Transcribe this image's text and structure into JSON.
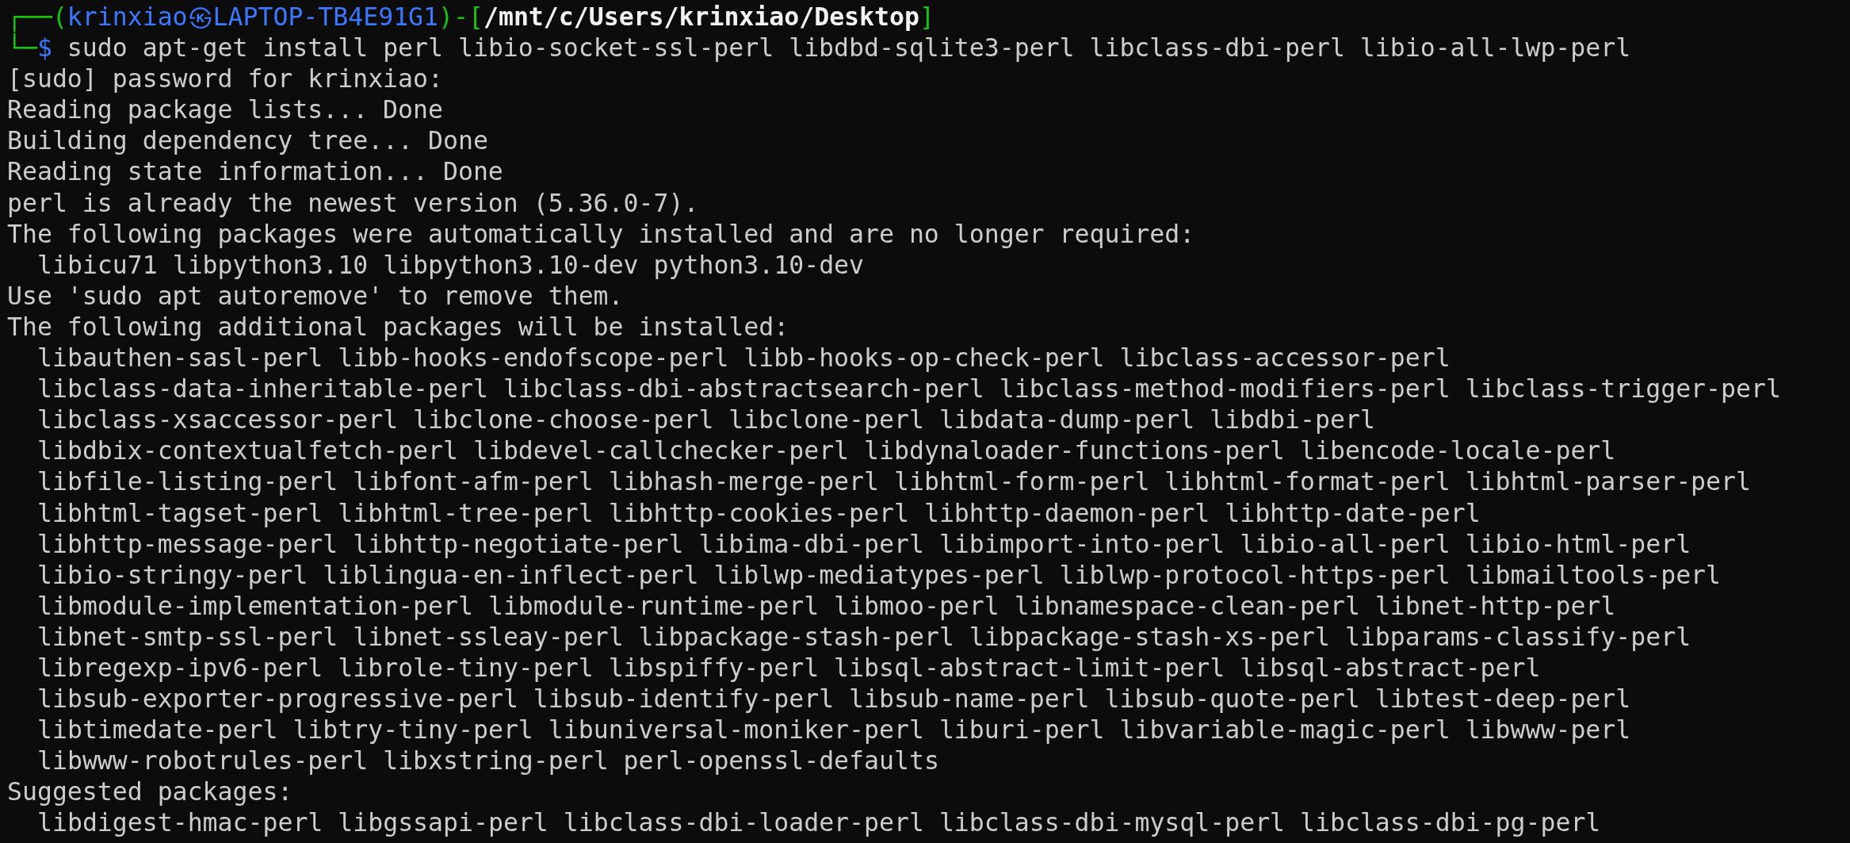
{
  "prompt": {
    "segments": [
      {
        "text": "┌──(",
        "kind": "frame"
      },
      {
        "text": "krinxiao㉿LAPTOP-TB4E91G1",
        "kind": "host"
      },
      {
        "text": ")-[",
        "kind": "frame"
      },
      {
        "text": "/mnt/c/Users/krinxiao/Desktop",
        "kind": "path"
      },
      {
        "text": "]",
        "kind": "frame"
      }
    ]
  },
  "command": {
    "segments": [
      {
        "text": "└─",
        "kind": "frame"
      },
      {
        "text": "$",
        "kind": "host"
      },
      {
        "text": " sudo apt-get install perl libio-socket-ssl-perl libdbd-sqlite3-perl libclass-dbi-perl libio-all-lwp-perl",
        "kind": "plain"
      }
    ]
  },
  "output": [
    {
      "kind": "line",
      "text": "[sudo] password for krinxiao:"
    },
    {
      "kind": "line",
      "text": "Reading package lists... Done"
    },
    {
      "kind": "line",
      "text": "Building dependency tree... Done"
    },
    {
      "kind": "line",
      "text": "Reading state information... Done"
    },
    {
      "kind": "line",
      "text": "perl is already the newest version (5.36.0-7)."
    },
    {
      "kind": "line",
      "text": "The following packages were automatically installed and are no longer required:"
    },
    {
      "kind": "indented",
      "text": "libicu71 libpython3.10 libpython3.10-dev python3.10-dev"
    },
    {
      "kind": "line",
      "text": "Use 'sudo apt autoremove' to remove them."
    },
    {
      "kind": "line",
      "text": "The following additional packages will be installed:"
    },
    {
      "kind": "indented",
      "text": "libauthen-sasl-perl libb-hooks-endofscope-perl libb-hooks-op-check-perl libclass-accessor-perl"
    },
    {
      "kind": "indented",
      "text": "libclass-data-inheritable-perl libclass-dbi-abstractsearch-perl libclass-method-modifiers-perl libclass-trigger-perl"
    },
    {
      "kind": "indented",
      "text": "libclass-xsaccessor-perl libclone-choose-perl libclone-perl libdata-dump-perl libdbi-perl"
    },
    {
      "kind": "indented",
      "text": "libdbix-contextualfetch-perl libdevel-callchecker-perl libdynaloader-functions-perl libencode-locale-perl"
    },
    {
      "kind": "indented",
      "text": "libfile-listing-perl libfont-afm-perl libhash-merge-perl libhtml-form-perl libhtml-format-perl libhtml-parser-perl"
    },
    {
      "kind": "indented",
      "text": "libhtml-tagset-perl libhtml-tree-perl libhttp-cookies-perl libhttp-daemon-perl libhttp-date-perl"
    },
    {
      "kind": "indented",
      "text": "libhttp-message-perl libhttp-negotiate-perl libima-dbi-perl libimport-into-perl libio-all-perl libio-html-perl"
    },
    {
      "kind": "indented",
      "text": "libio-stringy-perl liblingua-en-inflect-perl liblwp-mediatypes-perl liblwp-protocol-https-perl libmailtools-perl"
    },
    {
      "kind": "indented",
      "text": "libmodule-implementation-perl libmodule-runtime-perl libmoo-perl libnamespace-clean-perl libnet-http-perl"
    },
    {
      "kind": "indented",
      "text": "libnet-smtp-ssl-perl libnet-ssleay-perl libpackage-stash-perl libpackage-stash-xs-perl libparams-classify-perl"
    },
    {
      "kind": "indented",
      "text": "libregexp-ipv6-perl librole-tiny-perl libspiffy-perl libsql-abstract-limit-perl libsql-abstract-perl"
    },
    {
      "kind": "indented",
      "text": "libsub-exporter-progressive-perl libsub-identify-perl libsub-name-perl libsub-quote-perl libtest-deep-perl"
    },
    {
      "kind": "indented",
      "text": "libtimedate-perl libtry-tiny-perl libuniversal-moniker-perl liburi-perl libvariable-magic-perl libwww-perl"
    },
    {
      "kind": "indented",
      "text": "libwww-robotrules-perl libxstring-perl perl-openssl-defaults"
    },
    {
      "kind": "line",
      "text": "Suggested packages:"
    },
    {
      "kind": "indented",
      "text": "libdigest-hmac-perl libgssapi-perl libclass-dbi-loader-perl libclass-dbi-mysql-perl libclass-dbi-pg-perl"
    }
  ]
}
